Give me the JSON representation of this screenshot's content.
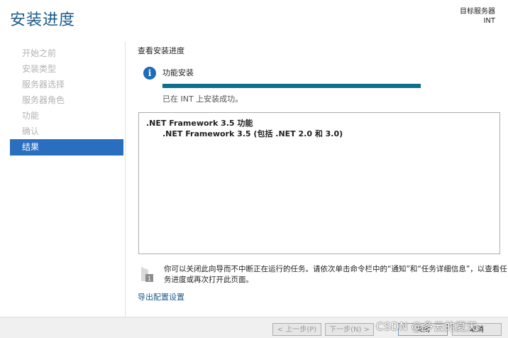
{
  "header": {
    "title": "安装进度",
    "target_label": "目标服务器",
    "target_value": "INT"
  },
  "sidebar": {
    "items": [
      {
        "label": "开始之前",
        "active": false
      },
      {
        "label": "安装类型",
        "active": false
      },
      {
        "label": "服务器选择",
        "active": false
      },
      {
        "label": "服务器角色",
        "active": false
      },
      {
        "label": "功能",
        "active": false
      },
      {
        "label": "确认",
        "active": false
      },
      {
        "label": "结果",
        "active": true
      }
    ]
  },
  "main": {
    "heading": "查看安装进度",
    "feature_label": "功能安装",
    "progress": 1.0,
    "status_text": "已在 INT 上安装成功。",
    "results": {
      "title": ".NET Framework 3.5 功能",
      "subitem": ".NET Framework 3.5 (包括 .NET 2.0 和 3.0)"
    },
    "note": "你可以关闭此向导而不中断正在运行的任务。请依次单击命令栏中的“通知”和“任务详细信息”，以查看任务进度或再次打开此页面。",
    "export_link": "导出配置设置"
  },
  "footer": {
    "prev_label": "< 上一步(P)",
    "next_label": "下一步(N) >",
    "close_label": "关闭",
    "cancel_label": "取消"
  },
  "watermark": "CSDN @多云的夏天",
  "colors": {
    "accent": "#2a6fbf",
    "title": "#1a5a8a",
    "progress": "#0e6f8c"
  },
  "icons": {
    "info": "info-icon",
    "note": "flag-note-icon"
  }
}
